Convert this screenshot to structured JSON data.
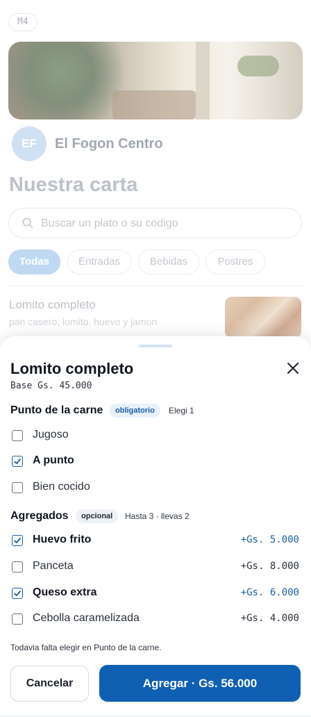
{
  "background": {
    "tag": "M4",
    "restaurant": {
      "initials": "EF",
      "name": "El Fogon Centro"
    },
    "page_title": "Nuestra carta",
    "search": {
      "placeholder": "Buscar un plato o su codigo"
    },
    "categories": [
      "Todas",
      "Entradas",
      "Bebidas",
      "Postres"
    ],
    "active_category": "Todas",
    "first_item": {
      "name": "Lomito completo",
      "description": "pan casero, lomito, huevo y jamon"
    }
  },
  "sheet": {
    "title": "Lomito completo",
    "base_price": "Base Gs. 45.000",
    "groups": [
      {
        "title": "Punto de la carne",
        "badge": "obligatorio",
        "rule": "Elegi 1",
        "options": [
          {
            "label": "Jugoso",
            "selected": false,
            "price": ""
          },
          {
            "label": "A punto",
            "selected": true,
            "price": ""
          },
          {
            "label": "Bien cocido",
            "selected": false,
            "price": ""
          }
        ]
      },
      {
        "title": "Agregados",
        "badge": "opcional",
        "rule": "Hasta 3 · llevas 2",
        "options": [
          {
            "label": "Huevo frito",
            "selected": true,
            "price": "+Gs. 5.000"
          },
          {
            "label": "Panceta",
            "selected": false,
            "price": "+Gs. 8.000"
          },
          {
            "label": "Queso extra",
            "selected": true,
            "price": "+Gs. 6.000"
          },
          {
            "label": "Cebolla caramelizada",
            "selected": false,
            "price": "+Gs. 4.000"
          }
        ]
      }
    ],
    "hint": "Todavia falta elegir en Punto de la carne.",
    "cancel_label": "Cancelar",
    "add_label": "Agregar · Gs. 56.000"
  },
  "colors": {
    "accent": "#0f5fb3",
    "badge_required_bg": "#e8f1fb",
    "check": "#1b5fa8"
  }
}
